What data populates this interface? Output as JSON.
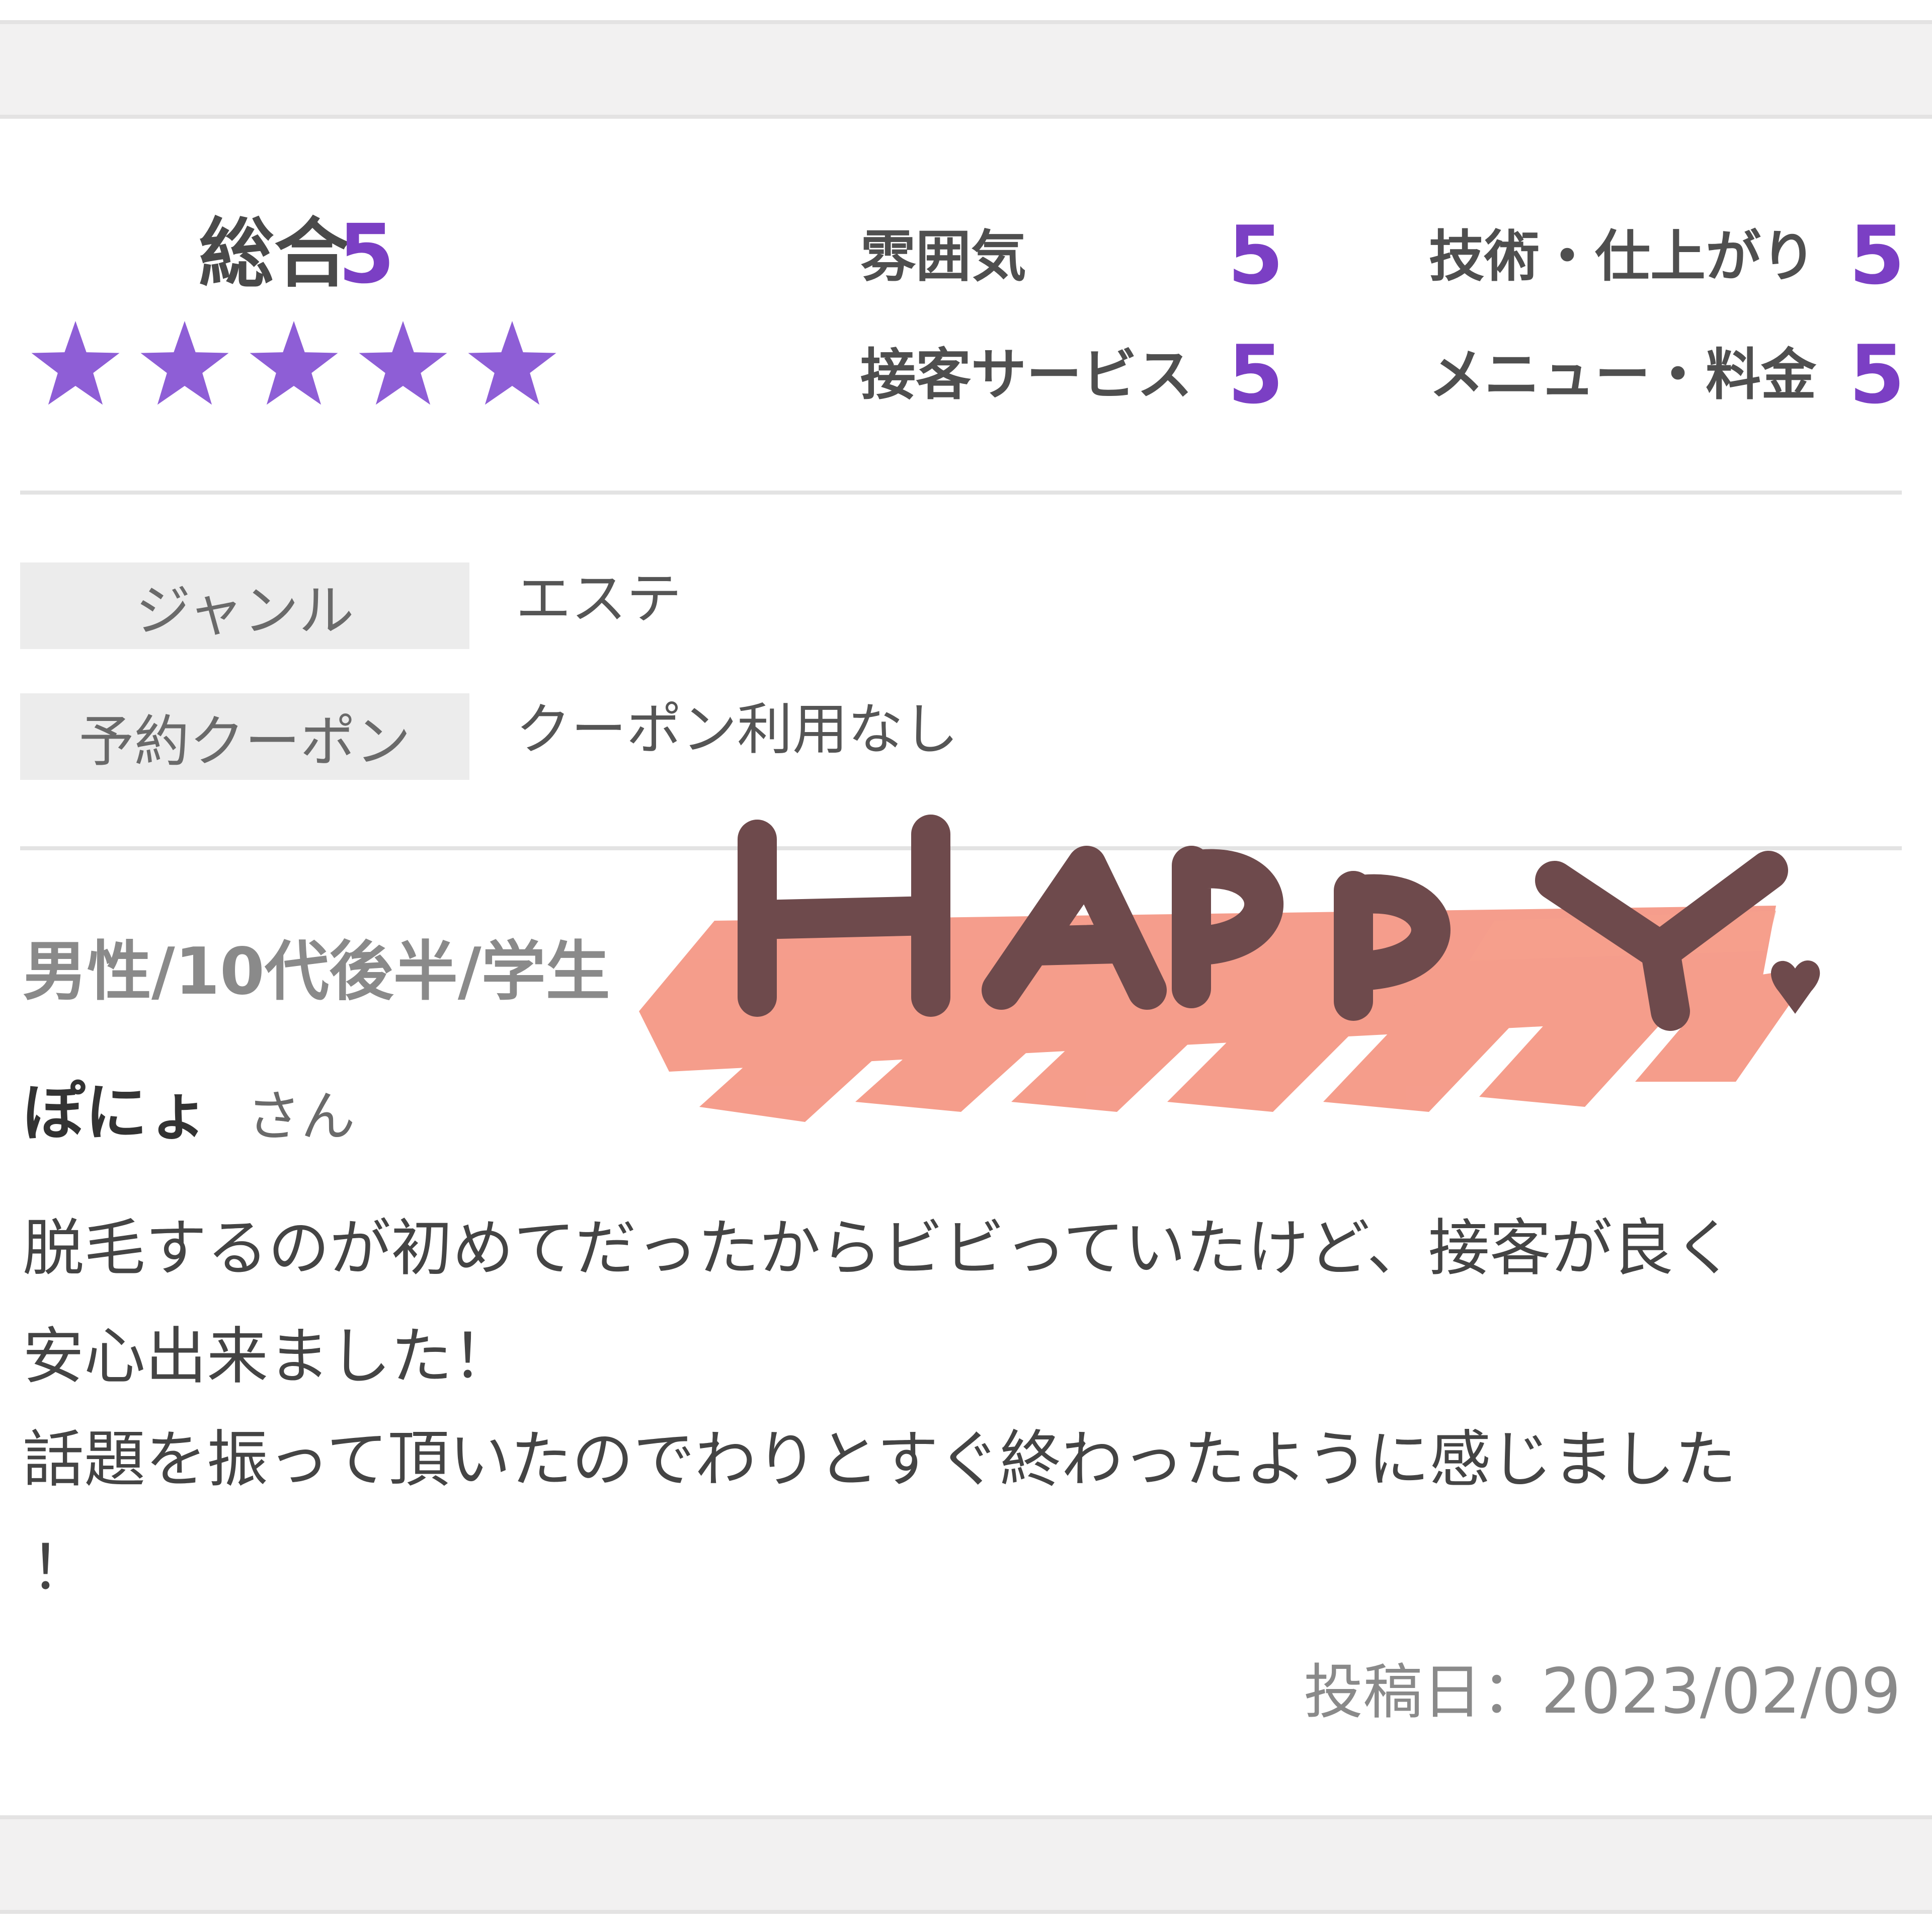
{
  "ratings": {
    "overall_label": "総合",
    "overall_score": "5",
    "star_count": 5,
    "max_stars": 5,
    "star_color": "#8e5ed6",
    "categories": [
      {
        "label": "雰囲気",
        "score": "5"
      },
      {
        "label": "技術・仕上がり",
        "score": "5"
      },
      {
        "label": "接客サービス",
        "score": "5"
      },
      {
        "label": "メニュー・料金",
        "score": "5"
      }
    ]
  },
  "info": {
    "genre_label": "ジャンル",
    "genre_value": "エステ",
    "coupon_label": "予約クーポン",
    "coupon_value": "クーポン利用なし"
  },
  "reviewer": {
    "profile": "男性/10代後半/学生",
    "nickname": "ぽにょ",
    "honorific": "さん"
  },
  "review": {
    "lines": [
      "脱毛するのが初めてだったからビビっていたけど、接客が良く",
      "安心出来ました！",
      "話題を振って頂いたのでわりとすぐ終わったように感じました",
      "！"
    ]
  },
  "posted": {
    "label": "投稿日：",
    "date": "2023/02/09"
  },
  "sticker": {
    "text": "HAPPY",
    "letter_color": "#6e4a4c",
    "brush_color": "#f4907c"
  },
  "colors": {
    "accent": "#7b3fc4",
    "band": "#f2f1f1"
  }
}
